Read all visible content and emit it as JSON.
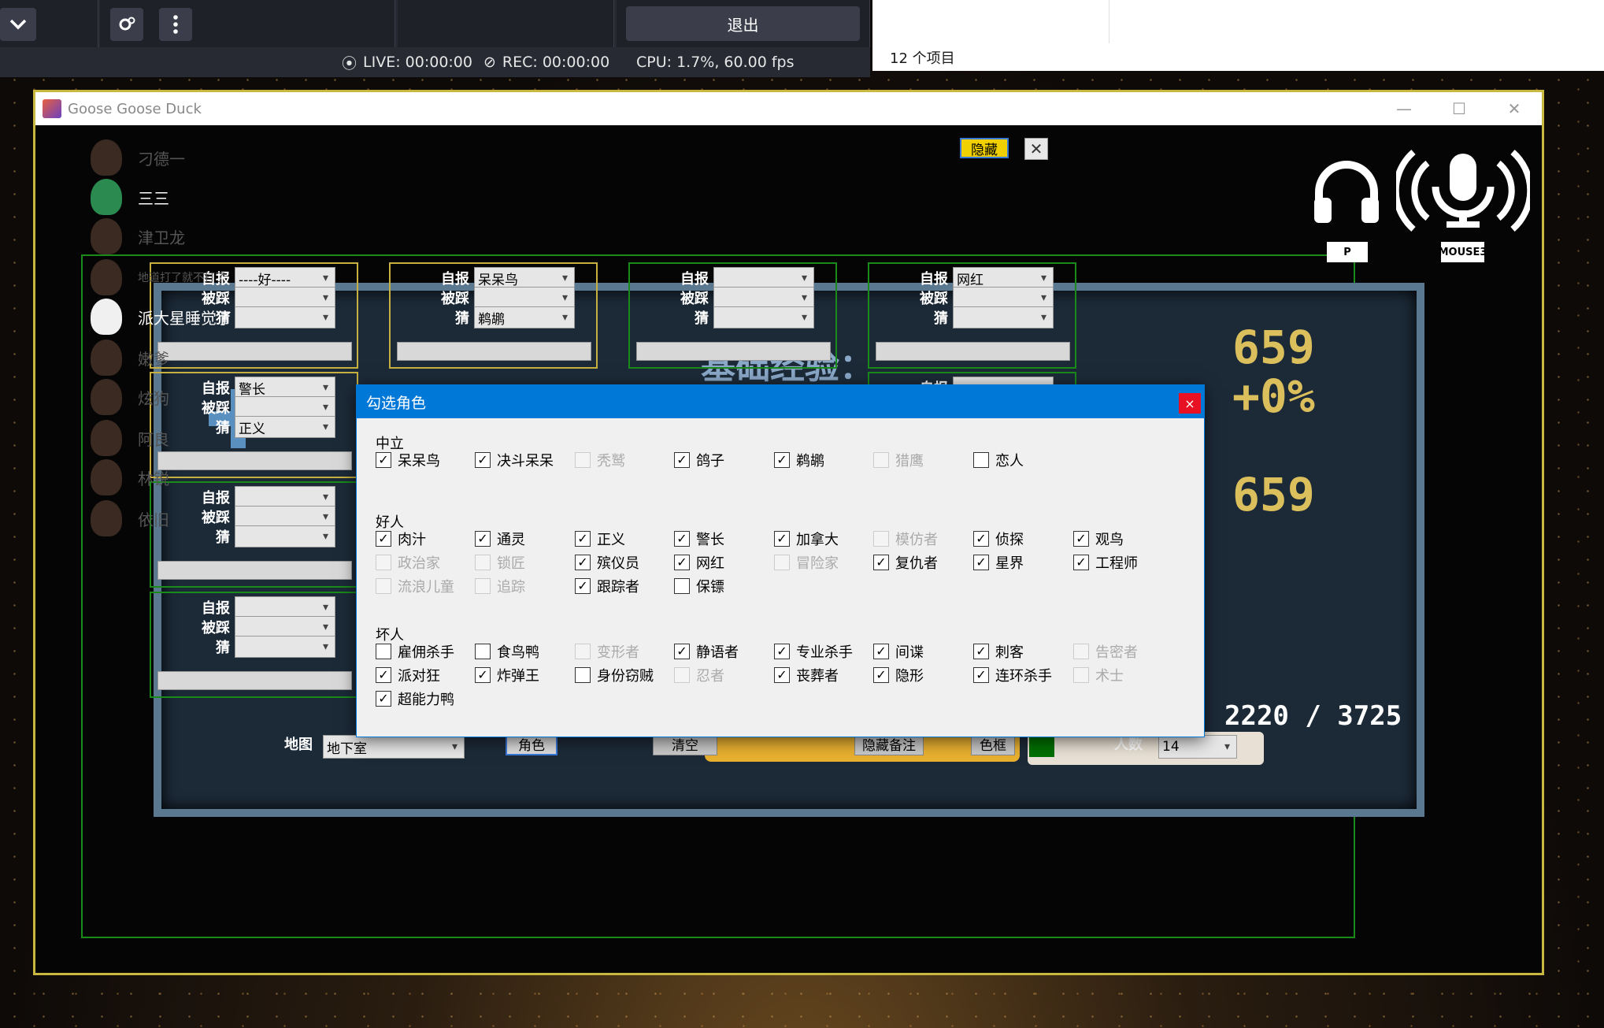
{
  "obs": {
    "exit_label": "退出",
    "live": "LIVE: 00:00:00",
    "rec": "REC: 00:00:00",
    "cpu": "CPU: 1.7%, 60.00 fps"
  },
  "explorer": {
    "item_count": "12 个项目"
  },
  "window": {
    "title": "Goose Goose Duck"
  },
  "players": [
    "刁德一",
    "三三",
    "津卫龙",
    "地道打了就不打了",
    "派大星睡觉了",
    "嫩爹",
    "炫狗",
    "阿良",
    "林锐",
    "依旧"
  ],
  "top_controls": {
    "hide_label": "隐藏",
    "close_glyph": "✕"
  },
  "hotkeys": {
    "headphone_key": "P",
    "mic_key": "MOUSE3"
  },
  "card_labels": {
    "self_report": "自报",
    "stepped": "被踩",
    "guess": "猜"
  },
  "cards": [
    {
      "self": "----好----",
      "stepped": "",
      "guess": ""
    },
    {
      "self": "呆呆鸟",
      "stepped": "",
      "guess": "鹈鹕"
    },
    {
      "self": "",
      "stepped": "",
      "guess": ""
    },
    {
      "self": "网红",
      "stepped": "",
      "guess": ""
    },
    {
      "self": "警长",
      "stepped": "",
      "guess": "正义"
    },
    {
      "self": "",
      "stepped": "",
      "guess": ""
    },
    {
      "self": "",
      "stepped": "",
      "guess": ""
    },
    {
      "self": "",
      "stepped": "",
      "guess": ""
    }
  ],
  "board": {
    "exp_label": "基础经验：",
    "num1": "659",
    "pct": "+0%",
    "num2": "659",
    "score": "2220 / 3725"
  },
  "bottom": {
    "map_label": "地图",
    "map_value": "地下室",
    "role_button": "角色",
    "clear_button": "清空",
    "hide_notes_button": "隐藏备注",
    "color_box_button": "色框",
    "count_label": "人数",
    "count_value": "14",
    "color_swatch": "#007000"
  },
  "dialog": {
    "title": "勾选角色",
    "close_glyph": "×",
    "groups": [
      {
        "name": "中立",
        "items": [
          {
            "label": "呆呆鸟",
            "checked": true,
            "enabled": true
          },
          {
            "label": "决斗呆呆",
            "checked": true,
            "enabled": true
          },
          {
            "label": "秃鹫",
            "checked": false,
            "enabled": false
          },
          {
            "label": "鸽子",
            "checked": true,
            "enabled": true
          },
          {
            "label": "鹈鹕",
            "checked": true,
            "enabled": true
          },
          {
            "label": "猎鹰",
            "checked": false,
            "enabled": false
          },
          {
            "label": "恋人",
            "checked": false,
            "enabled": true
          }
        ]
      },
      {
        "name": "好人",
        "items": [
          {
            "label": "肉汁",
            "checked": true,
            "enabled": true
          },
          {
            "label": "通灵",
            "checked": true,
            "enabled": true
          },
          {
            "label": "正义",
            "checked": true,
            "enabled": true
          },
          {
            "label": "警长",
            "checked": true,
            "enabled": true
          },
          {
            "label": "加拿大",
            "checked": true,
            "enabled": true
          },
          {
            "label": "模仿者",
            "checked": false,
            "enabled": false
          },
          {
            "label": "侦探",
            "checked": true,
            "enabled": true
          },
          {
            "label": "观鸟",
            "checked": true,
            "enabled": true
          },
          {
            "label": "政治家",
            "checked": false,
            "enabled": false
          },
          {
            "label": "锁匠",
            "checked": false,
            "enabled": false
          },
          {
            "label": "殡仪员",
            "checked": true,
            "enabled": true
          },
          {
            "label": "网红",
            "checked": true,
            "enabled": true
          },
          {
            "label": "冒险家",
            "checked": false,
            "enabled": false
          },
          {
            "label": "复仇者",
            "checked": true,
            "enabled": true
          },
          {
            "label": "星界",
            "checked": true,
            "enabled": true
          },
          {
            "label": "工程师",
            "checked": true,
            "enabled": true
          },
          {
            "label": "流浪儿童",
            "checked": false,
            "enabled": false
          },
          {
            "label": "追踪",
            "checked": false,
            "enabled": false
          },
          {
            "label": "跟踪者",
            "checked": true,
            "enabled": true
          },
          {
            "label": "保镖",
            "checked": false,
            "enabled": true
          }
        ]
      },
      {
        "name": "坏人",
        "items": [
          {
            "label": "雇佣杀手",
            "checked": false,
            "enabled": true
          },
          {
            "label": "食鸟鸭",
            "checked": false,
            "enabled": true
          },
          {
            "label": "变形者",
            "checked": false,
            "enabled": false
          },
          {
            "label": "静语者",
            "checked": true,
            "enabled": true
          },
          {
            "label": "专业杀手",
            "checked": true,
            "enabled": true
          },
          {
            "label": "间谍",
            "checked": true,
            "enabled": true
          },
          {
            "label": "刺客",
            "checked": true,
            "enabled": true
          },
          {
            "label": "告密者",
            "checked": false,
            "enabled": false
          },
          {
            "label": "派对狂",
            "checked": true,
            "enabled": true
          },
          {
            "label": "炸弹王",
            "checked": true,
            "enabled": true
          },
          {
            "label": "身份窃贼",
            "checked": false,
            "enabled": true
          },
          {
            "label": "忍者",
            "checked": false,
            "enabled": false
          },
          {
            "label": "丧葬者",
            "checked": true,
            "enabled": true
          },
          {
            "label": "隐形",
            "checked": true,
            "enabled": true
          },
          {
            "label": "连环杀手",
            "checked": true,
            "enabled": true
          },
          {
            "label": "术士",
            "checked": false,
            "enabled": false
          },
          {
            "label": "超能力鸭",
            "checked": true,
            "enabled": true
          }
        ]
      }
    ]
  }
}
